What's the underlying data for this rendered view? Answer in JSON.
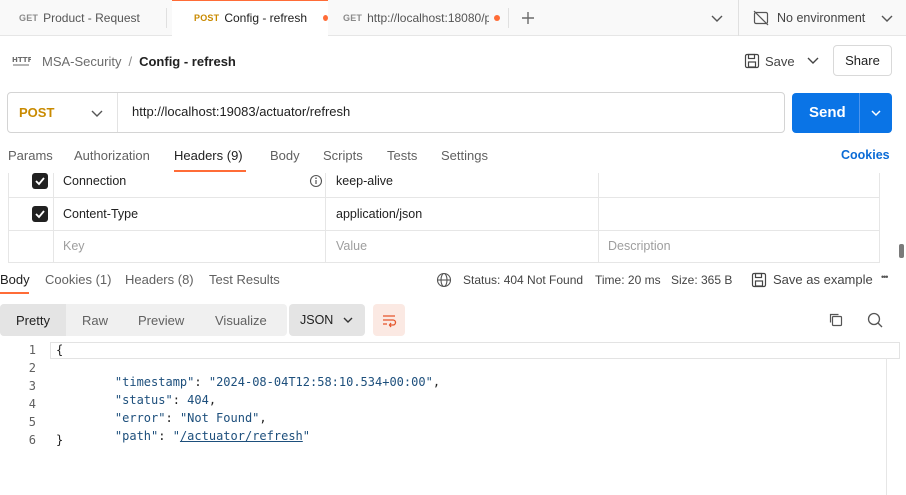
{
  "tabs": [
    {
      "method": "GET",
      "label": "Product - Request",
      "method_color": "#2e7d32",
      "dirty": false
    },
    {
      "method": "POST",
      "label": "Config - refresh",
      "method_color": "#c98a00",
      "dirty": true
    },
    {
      "method": "GET",
      "label": "http://localhost:18080/p",
      "method_color": "#2e7d32",
      "dirty": true
    }
  ],
  "environment": {
    "label": "No environment"
  },
  "breadcrumb": {
    "collection": "MSA-Security",
    "separator": "/",
    "request": "Config - refresh",
    "http_badge": "HTTP"
  },
  "toolbar": {
    "save_label": "Save",
    "share_label": "Share"
  },
  "request": {
    "method": "POST",
    "url": "http://localhost:19083/actuator/refresh",
    "send_label": "Send"
  },
  "request_tabs": [
    {
      "label": "Params"
    },
    {
      "label": "Authorization"
    },
    {
      "label": "Headers (9)"
    },
    {
      "label": "Body"
    },
    {
      "label": "Scripts"
    },
    {
      "label": "Tests"
    },
    {
      "label": "Settings"
    }
  ],
  "cookies_label": "Cookies",
  "headers": {
    "rows": [
      {
        "key": "Connection",
        "value": "keep-alive",
        "checked": true,
        "info": true
      },
      {
        "key": "Content-Type",
        "value": "application/json",
        "checked": true,
        "info": false
      }
    ],
    "placeholder": {
      "key": "Key",
      "value": "Value",
      "description": "Description"
    }
  },
  "response_tabs": [
    {
      "label": "Body"
    },
    {
      "label": "Cookies (1)"
    },
    {
      "label": "Headers (8)"
    },
    {
      "label": "Test Results"
    }
  ],
  "response_meta": {
    "status": "Status: 404 Not Found",
    "time": "Time: 20 ms",
    "size": "Size: 365 B",
    "save_example": "Save as example",
    "more": "•••"
  },
  "view_modes": [
    {
      "label": "Pretty"
    },
    {
      "label": "Raw"
    },
    {
      "label": "Preview"
    },
    {
      "label": "Visualize"
    }
  ],
  "format": "JSON",
  "code": {
    "line_numbers": [
      "1",
      "2",
      "3",
      "4",
      "5",
      "6"
    ],
    "open_brace": "{",
    "close_brace": "}",
    "fields": [
      {
        "key": "\"timestamp\"",
        "sep": ": ",
        "value": "\"2024-08-04T12:58:10.534+00:00\"",
        "comma": ","
      },
      {
        "key": "\"status\"",
        "sep": ": ",
        "value": "404",
        "comma": ","
      },
      {
        "key": "\"error\"",
        "sep": ": ",
        "value": "\"Not Found\"",
        "comma": ","
      },
      {
        "key": "\"path\"",
        "sep": ": ",
        "value_q1": "\"",
        "value_link": "/actuator/refresh",
        "value_q2": "\"",
        "comma": ""
      }
    ]
  },
  "colors": {
    "accent": "#ff6c37",
    "send": "#0a74e6",
    "post": "#c98a00",
    "get": "#2e7d32"
  }
}
